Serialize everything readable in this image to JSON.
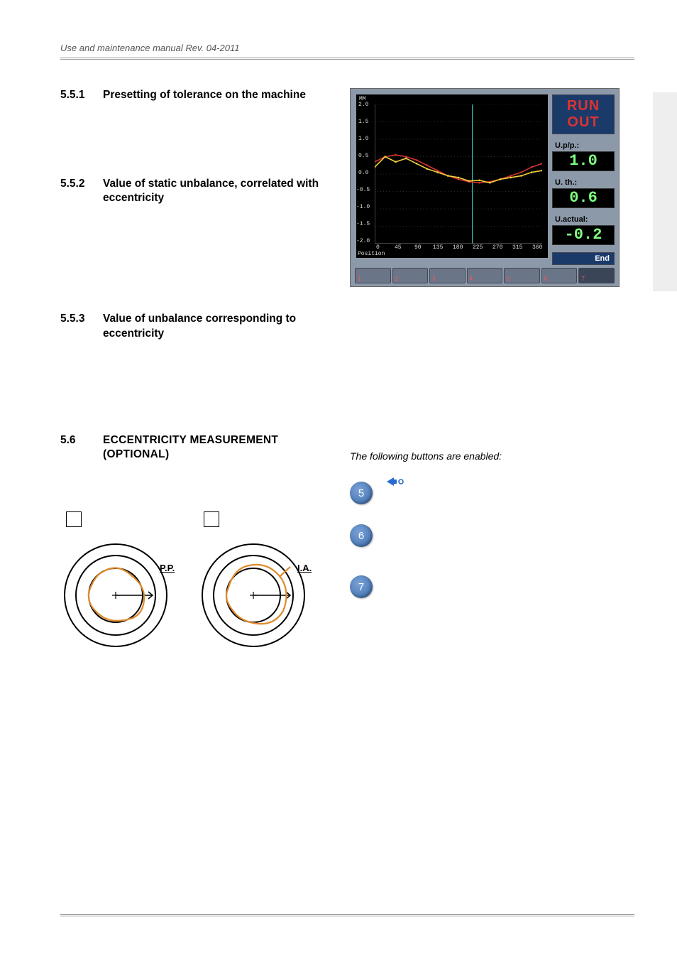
{
  "header": "Use and maintenance manual Rev. 04-2011",
  "sections": {
    "s551": {
      "num": "5.5.1",
      "title": "Presetting of tolerance on the machine"
    },
    "s552": {
      "num": "5.5.2",
      "title": "Value of static unbalance, correlated with eccentricity"
    },
    "s553": {
      "num": "5.5.3",
      "title": "Value of unbalance corresponding to eccentricity"
    },
    "s56": {
      "num": "5.6",
      "title": "ECCENTRICITY MEASUREMENT (OPTIONAL)"
    }
  },
  "runout": {
    "title": "RUN OUT",
    "labels": {
      "upp": "U.p/p.:",
      "uth": "U. th.:",
      "uactual": "U.actual:"
    },
    "values": {
      "upp": "1.0",
      "uth": "0.6",
      "uactual": "-0.2"
    },
    "end": "End",
    "y_unit": "MM",
    "y_ticks": [
      "2.0",
      "1.5",
      "1.0",
      "0.5",
      "0.0",
      "-0.5",
      "-1.0",
      "-1.5",
      "-2.0"
    ],
    "x_ticks": [
      "0",
      "45",
      "90",
      "135",
      "180",
      "225",
      "270",
      "315",
      "360"
    ],
    "x_label": "Position",
    "strip_buttons": [
      "1",
      "2",
      "3",
      "4",
      "5",
      "6",
      "7"
    ],
    "active_strip": 7
  },
  "chart_data": {
    "type": "line",
    "title": "RUN OUT",
    "xlabel": "Position",
    "ylabel": "MM",
    "xlim": [
      0,
      360
    ],
    "ylim": [
      -2.0,
      2.0
    ],
    "x": [
      0,
      22.5,
      45,
      67.5,
      90,
      112.5,
      135,
      157.5,
      180,
      202.5,
      225,
      247.5,
      270,
      292.5,
      315,
      337.5,
      360
    ],
    "series": [
      {
        "name": "red",
        "color": "#d33333",
        "values": [
          0.35,
          0.5,
          0.55,
          0.5,
          0.4,
          0.25,
          0.1,
          -0.05,
          -0.15,
          -0.22,
          -0.25,
          -0.22,
          -0.15,
          -0.05,
          0.05,
          0.2,
          0.3
        ]
      },
      {
        "name": "yellow",
        "color": "#f2d13a",
        "values": [
          0.2,
          0.5,
          0.35,
          0.45,
          0.3,
          0.15,
          0.05,
          -0.05,
          -0.1,
          -0.2,
          -0.18,
          -0.25,
          -0.15,
          -0.1,
          -0.05,
          0.05,
          0.1
        ]
      }
    ]
  },
  "following": "The following buttons are enabled:",
  "buttons": {
    "b5": "5",
    "b6": "6",
    "b7": "7"
  },
  "diagrams": {
    "pp": "P.P.",
    "ia": "I.A."
  }
}
